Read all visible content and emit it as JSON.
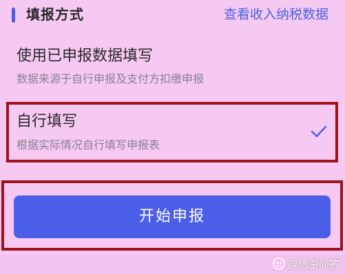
{
  "header": {
    "title": "填报方式",
    "link": "查看收入纳税数据"
  },
  "options": [
    {
      "title": "使用已申报数据填写",
      "desc": "数据来源于自行申报及支付方扣缴申报",
      "selected": false
    },
    {
      "title": "自行填写",
      "desc": "根据实际情况自行填写申报表",
      "selected": true
    }
  ],
  "start_button": {
    "label": "开始申报"
  },
  "watermark": {
    "text": "@悟空问答",
    "icon": "wukong-logo-icon"
  },
  "colors": {
    "background": "#f6c9f3",
    "accent": "#4b5ee8",
    "link": "#4b63e0",
    "highlight_frame": "#a0101a"
  }
}
